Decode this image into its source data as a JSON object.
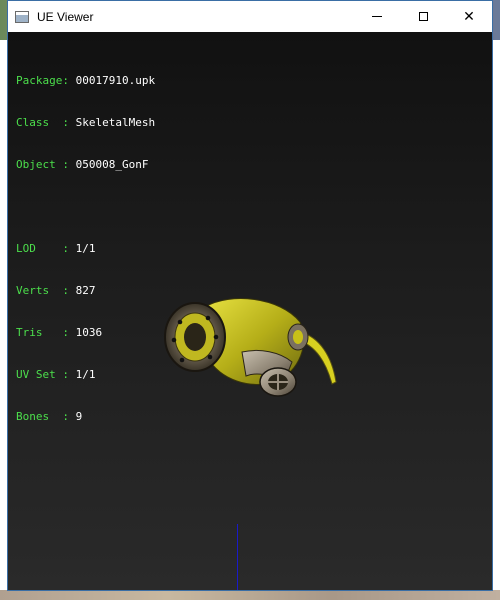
{
  "window": {
    "title": "UE Viewer",
    "minimize_symbol": "",
    "maximize_symbol": "",
    "close_symbol": "✕"
  },
  "info": {
    "package": {
      "key": "Package:",
      "value": "00017910.upk"
    },
    "class": {
      "key": "Class  :",
      "value": "SkeletalMesh"
    },
    "object": {
      "key": "Object :",
      "value": "050008_GonF"
    },
    "lod": {
      "key": "LOD    :",
      "value": "1/1"
    },
    "verts": {
      "key": "Verts  :",
      "value": "827"
    },
    "tris": {
      "key": "Tris   :",
      "value": "1036"
    },
    "uvset": {
      "key": "UV Set :",
      "value": "1/1"
    },
    "bones": {
      "key": "Bones  :",
      "value": "9"
    }
  },
  "colors": {
    "label": "#4cdf4c",
    "value": "#ffffff",
    "axis": "#1a1ac8",
    "mesh_yellow": "#c9c21e"
  }
}
